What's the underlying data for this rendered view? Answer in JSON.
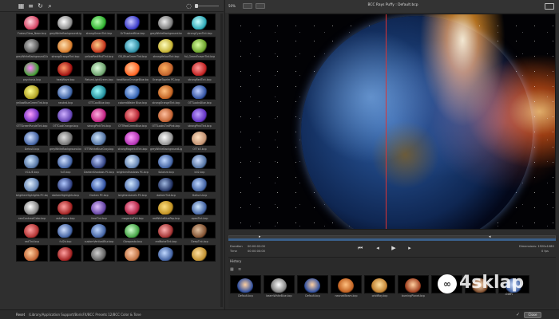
{
  "left": {
    "rows": [
      [
        {
          "label": "Fusion/Glow_Neon.bcp",
          "c1": "#ffd7e0",
          "c2": "#d44060"
        },
        {
          "label": "greyWhiteBackgroundLight.bcp",
          "c1": "#ffffff",
          "c2": "#888888"
        },
        {
          "label": "strongGreenTint.bcp",
          "c1": "#b7ffb0",
          "c2": "#2cae2c"
        },
        {
          "label": "GrThaatedBlue.bcp",
          "c1": "#c8c8ff",
          "c2": "#3737c8"
        },
        {
          "label": "greyWhiteBackground.bcp",
          "c1": "#eeeeee",
          "c2": "#777777"
        },
        {
          "label": "strongCyanTint.bcp",
          "c1": "#c9ffff",
          "c2": "#2aa7b5"
        }
      ],
      [
        {
          "label": "greyWhiteBackground2.bcp",
          "c1": "#cccccc",
          "c2": "#555555"
        },
        {
          "label": "strongOrangeTint.bcp",
          "c1": "#ffe0b0",
          "c2": "#d57a2a"
        },
        {
          "label": "yellowRedMistTint.bcp",
          "c1": "#ffd08b",
          "c2": "#c2321a"
        },
        {
          "label": "GR_BlueGreenTint.bcp",
          "c1": "#b0f0ff",
          "c2": "#2a8aa0"
        },
        {
          "label": "strongYellowTint.bcp",
          "c1": "#ffffc0",
          "c2": "#c4b030"
        },
        {
          "label": "ful_GreenEraserTint.bcp",
          "c1": "#d8ffa0",
          "c2": "#6aa02a"
        }
      ],
      [
        {
          "label": "psychosis.bcp",
          "c1": "#ff80ff",
          "c2": "#40a030"
        },
        {
          "label": "heatWave.bcp",
          "c1": "#ff9a6a",
          "c2": "#a01010"
        },
        {
          "label": "ReturnLightGreen.bcp",
          "c1": "#e0ffe0",
          "c2": "#6ba06b"
        },
        {
          "label": "heatWaveOrangeBlue.bcp",
          "c1": "#ffd0a0",
          "c2": "#ff6020"
        },
        {
          "label": "OrangeToprim PC.bcp",
          "c1": "#ffb060",
          "c2": "#c0602a"
        },
        {
          "label": "strongRedTint.bcp",
          "c1": "#ff9a9a",
          "c2": "#c02020"
        }
      ],
      [
        {
          "label": "yellowBlueGreenTint.bcp",
          "c1": "#ffff90",
          "c2": "#b0a020"
        },
        {
          "label": "neutral.bcp",
          "c1": "#cfe0ff",
          "c2": "#3a5fa0"
        },
        {
          "label": "OTTCoolBlue.bcp",
          "c1": "#a0ffff",
          "c2": "#208c9a"
        },
        {
          "label": "coloredWater Blue.bcp",
          "c1": "#c0d8ff",
          "c2": "#3060b0"
        },
        {
          "label": "strongOrangeTint.bcp",
          "c1": "#ffc080",
          "c2": "#c06020"
        },
        {
          "label": "OTTLooksBlue.bcp",
          "c1": "#c0d0ff",
          "c2": "#3050a0"
        }
      ],
      [
        {
          "label": "OTTGreenPurpleTint.bcp",
          "c1": "#ffa0ff",
          "c2": "#7030c0"
        },
        {
          "label": "OTTCoolOrange.bcp",
          "c1": "#d0b0ff",
          "c2": "#6040b0"
        },
        {
          "label": "strongPinkTint.bcp",
          "c1": "#ffb0e0",
          "c2": "#c02080"
        },
        {
          "label": "OTTRedGreenBlue.bcp",
          "c1": "#ffa0a0",
          "c2": "#b02030"
        },
        {
          "label": "OTTLooksTintPink.bcp",
          "c1": "#ffc0a0",
          "c2": "#c06030"
        },
        {
          "label": "strongPinkTint.bcp",
          "c1": "#c0a0ff",
          "c2": "#6030c0"
        }
      ],
      [
        {
          "label": "Default.bcp",
          "c1": "#d0e0ff",
          "c2": "#4060a0"
        },
        {
          "label": "greyWhiteBackground.bcp",
          "c1": "#e0e0e0",
          "c2": "#707070"
        },
        {
          "label": "OTTWhiteBlueGray.bcp",
          "c1": "#d0e8ff",
          "c2": "#5070a0"
        },
        {
          "label": "strongMagentaTint.bcp",
          "c1": "#ffa0ff",
          "c2": "#b030b0"
        },
        {
          "label": "greyWhiteBackgroundLight.bcp",
          "c1": "#ffffff",
          "c2": "#909090"
        },
        {
          "label": "OTTb3.bcp",
          "c1": "#ffe0c0",
          "c2": "#c09070"
        }
      ],
      [
        {
          "label": "VCLUE.bcp",
          "c1": "#d0e8ff",
          "c2": "#5070a0"
        },
        {
          "label": "ful3.bcp",
          "c1": "#d0e0ff",
          "c2": "#4060a0"
        },
        {
          "label": "DarkenShadows PC.bcp",
          "c1": "#c0d0ff",
          "c2": "#304080"
        },
        {
          "label": "brightenShadows PC.bcp",
          "c1": "#e0f0ff",
          "c2": "#6080b0"
        },
        {
          "label": "Solarize.bcp",
          "c1": "#c0d8ff",
          "c2": "#4060a0"
        },
        {
          "label": "b02.bcp",
          "c1": "#d0e0ff",
          "c2": "#5070a0"
        }
      ],
      [
        {
          "label": "brightenHighlights PC.bcp",
          "c1": "#e0f0ff",
          "c2": "#6080b0"
        },
        {
          "label": "darkenHighlights.bcp",
          "c1": "#b0c8ff",
          "c2": "#304080"
        },
        {
          "label": "Darken PC.bcp",
          "c1": "#c0d8ff",
          "c2": "#3050a0"
        },
        {
          "label": "brightenLevels PC.bcp",
          "c1": "#d0e8ff",
          "c2": "#5070b0"
        },
        {
          "label": "darkenTint.bcp",
          "c1": "#a0b8e0",
          "c2": "#203060"
        },
        {
          "label": "Daltum.bcp",
          "c1": "#c0d8ff",
          "c2": "#4060a0"
        }
      ],
      [
        {
          "label": "neoContrastColor.bcp",
          "c1": "#ffffff",
          "c2": "#808080"
        },
        {
          "label": "autoBrace.bcp",
          "c1": "#ffa0a0",
          "c2": "#a02020"
        },
        {
          "label": "limeTint.bcp",
          "c1": "#e0c0ff",
          "c2": "#6040a0"
        },
        {
          "label": "magentaTint.bcp",
          "c1": "#ffa0c0",
          "c2": "#b02040"
        },
        {
          "label": "redWhiteBluePop.bcp",
          "c1": "#ffe080",
          "c2": "#c09020"
        },
        {
          "label": "apeaTint.bcp",
          "c1": "#d0e8ff",
          "c2": "#4060a0"
        }
      ],
      [
        {
          "label": "redTint.bcp",
          "c1": "#ffa0a0",
          "c2": "#b03030"
        },
        {
          "label": "ful2b.bcp",
          "c1": "#d0e0ff",
          "c2": "#4060a0"
        },
        {
          "label": "customVerticalBlur.bcp",
          "c1": "#c0d8ff",
          "c2": "#4060a0"
        },
        {
          "label": "Glowpasta.bcp",
          "c1": "#d0ffd0",
          "c2": "#40a040"
        },
        {
          "label": "redNoiseTint.bcp",
          "c1": "#ffb0b0",
          "c2": "#a03030"
        },
        {
          "label": "DeepTint.bcp",
          "c1": "#e0c0a0",
          "c2": "#805030"
        }
      ],
      [
        {
          "label": "",
          "c1": "#ffd0a0",
          "c2": "#c06030"
        },
        {
          "label": "",
          "c1": "#ffa0a0",
          "c2": "#a02020"
        },
        {
          "label": "",
          "c1": "#d0d0d0",
          "c2": "#606060"
        },
        {
          "label": "",
          "c1": "#ffd0b0",
          "c2": "#c07040"
        },
        {
          "label": "",
          "c1": "#c0d8ff",
          "c2": "#4060a0"
        },
        {
          "label": "",
          "c1": "#ffe0a0",
          "c2": "#c09030"
        }
      ]
    ]
  },
  "viewer": {
    "zoom": "50%",
    "title": "BCC Rays Puffy : Default.bcp",
    "duration_label": "Duration",
    "duration_value": "00:00:02:00",
    "time_label": "Time",
    "time_value": "00:00:00:00",
    "dimensions": "Dimensions: 1920x1080",
    "fps": "0 fps"
  },
  "history": {
    "title": "History",
    "items": [
      {
        "label": "Default.bcp",
        "c1": "#ffd0a0",
        "c2": "#3050a0"
      },
      {
        "label": "beamWhiteBlue.bcp",
        "c1": "#ffffff",
        "c2": "#808080"
      },
      {
        "label": "Default.bcp",
        "c1": "#ffd0a0",
        "c2": "#3050a0"
      },
      {
        "label": "neonedBeam.bcp",
        "c1": "#ffc080",
        "c2": "#c06020"
      },
      {
        "label": "orbitRay.bcp",
        "c1": "#ffe0a0",
        "c2": "#c08030"
      },
      {
        "label": "burningPlanet.bcp",
        "c1": "#ffd0a0",
        "c2": "#a04020"
      },
      {
        "label": "",
        "c1": "#ffc080",
        "c2": "#803020"
      },
      {
        "label": "",
        "c1": "#ffe0c0",
        "c2": "#805030"
      },
      {
        "label": "",
        "c1": "#d0e0ff",
        "c2": "#4060a0"
      }
    ]
  },
  "status": {
    "reset": "Reset",
    "path": "/Library/Application Support/BorisFX/BCC Presets 12/BCC Color & Tone",
    "close": "Close"
  },
  "watermark": {
    "brand": "4sklap",
    "sub": ".com"
  }
}
